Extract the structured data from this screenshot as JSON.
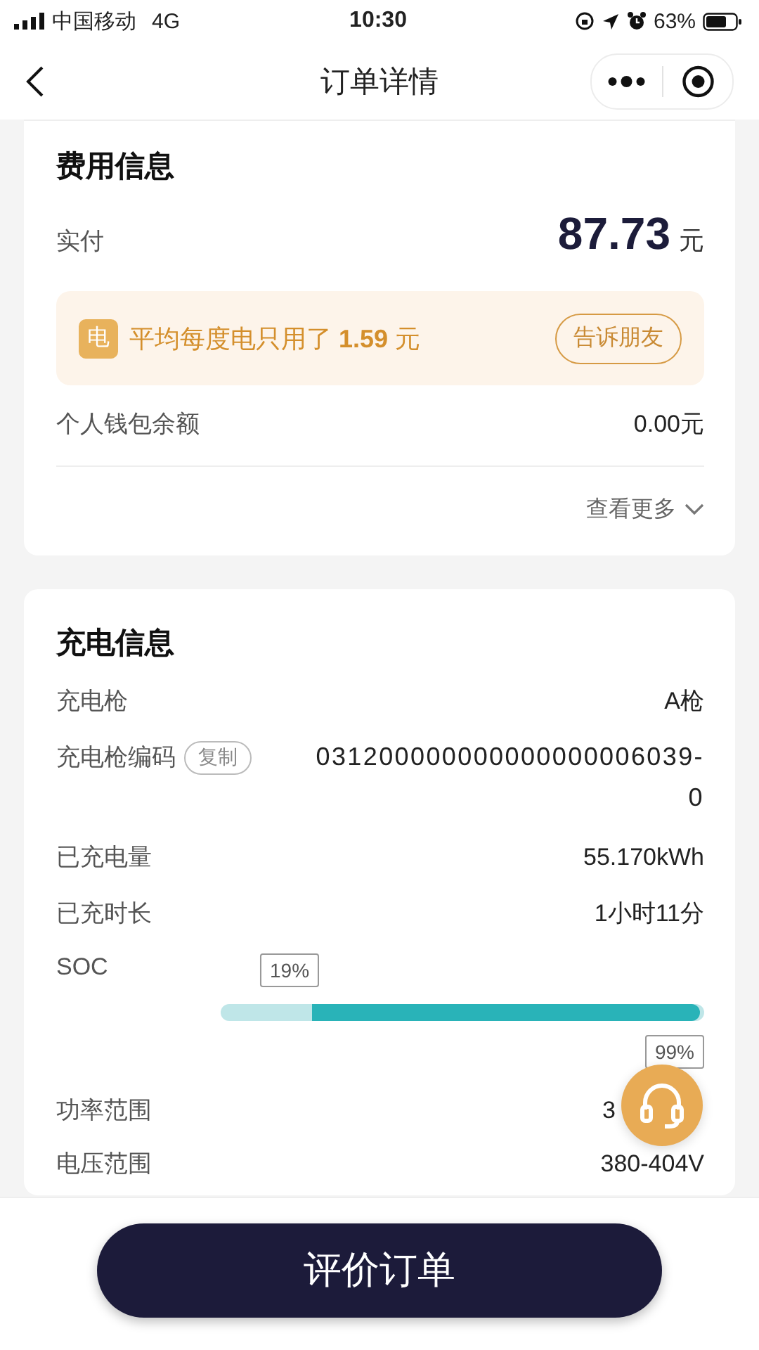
{
  "status_bar": {
    "carrier": "中国移动",
    "network": "4G",
    "time": "10:30",
    "battery": "63%"
  },
  "nav": {
    "title": "订单详情"
  },
  "fee_card": {
    "title": "费用信息",
    "paid_label": "实付",
    "paid_amount": "87.73",
    "paid_unit": "元",
    "promo": {
      "badge": "电",
      "text": "平均每度电只用了 **1.59** 元",
      "button": "告诉朋友"
    },
    "rows": [
      {
        "label": "个人钱包余额",
        "value": "0.00元"
      }
    ],
    "more": "查看更多"
  },
  "charge_card": {
    "title": "充电信息",
    "rows": [
      {
        "kind": "text",
        "label": "充电枪",
        "value": "A枪"
      },
      {
        "kind": "copy",
        "label": "充电枪编码",
        "button": "复制",
        "value": "031200000000000000006039-0"
      },
      {
        "kind": "text",
        "label": "已充电量",
        "value": "55.170kWh"
      },
      {
        "kind": "text",
        "label": "已充时长",
        "value": "1小时11分"
      },
      {
        "kind": "soc",
        "label": "SOC",
        "start": {
          "reading": "19%"
        },
        "end": {
          "reading": "99%"
        }
      },
      {
        "kind": "covered",
        "label": "功率范围",
        "value": "3"
      },
      {
        "kind": "text",
        "label": "电压范围",
        "value": "380-404V"
      }
    ]
  },
  "bottom": {
    "button": "评价订单"
  }
}
